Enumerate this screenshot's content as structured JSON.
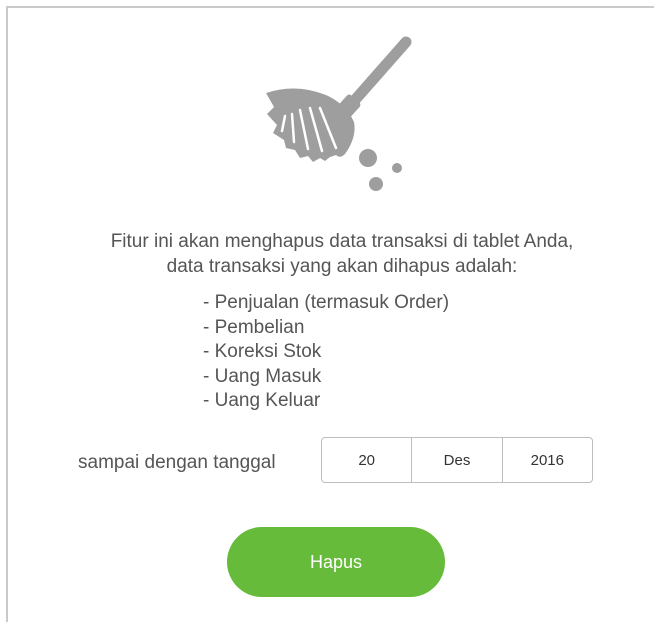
{
  "dialog": {
    "icon": "broom-icon",
    "description_line1": "Fitur ini akan menghapus data transaksi di tablet Anda,",
    "description_line2": "data transaksi yang akan dihapus adalah:",
    "items": [
      "- Penjualan (termasuk Order)",
      "- Pembelian",
      "- Koreksi Stok",
      "- Uang Masuk",
      "- Uang Keluar"
    ],
    "date_label": "sampai dengan tanggal",
    "date": {
      "day": "20",
      "month": "Des",
      "year": "2016"
    },
    "button_label": "Hapus"
  },
  "colors": {
    "accent": "#66bb3a",
    "icon": "#9e9e9e",
    "text": "#555555",
    "border": "#bdbdbd"
  }
}
